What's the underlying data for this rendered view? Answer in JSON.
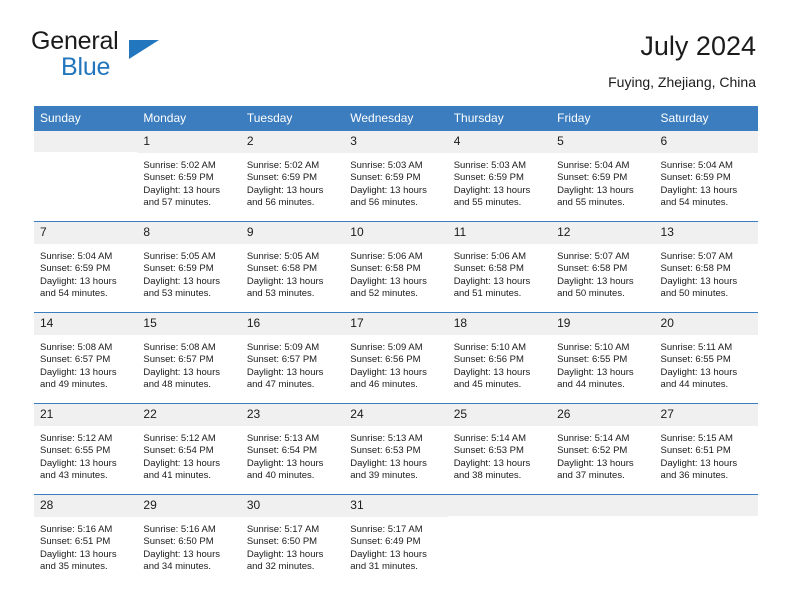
{
  "brand": {
    "line1": "General",
    "line2": "Blue",
    "accent_color": "#2176bd"
  },
  "header": {
    "title": "July 2024",
    "subtitle": "Fuying, Zhejiang, China",
    "header_bg": "#3b7dbf",
    "daynum_bg": "#f0f0f0"
  },
  "weekdays": [
    "Sunday",
    "Monday",
    "Tuesday",
    "Wednesday",
    "Thursday",
    "Friday",
    "Saturday"
  ],
  "labels": {
    "sunrise_prefix": "Sunrise:",
    "sunset_prefix": "Sunset:",
    "daylight_prefix": "Daylight:"
  },
  "weeks": [
    [
      {
        "day": "",
        "empty": true
      },
      {
        "day": "1",
        "sunrise": "Sunrise: 5:02 AM",
        "sunset": "Sunset: 6:59 PM",
        "daylight1": "Daylight: 13 hours",
        "daylight2": "and 57 minutes."
      },
      {
        "day": "2",
        "sunrise": "Sunrise: 5:02 AM",
        "sunset": "Sunset: 6:59 PM",
        "daylight1": "Daylight: 13 hours",
        "daylight2": "and 56 minutes."
      },
      {
        "day": "3",
        "sunrise": "Sunrise: 5:03 AM",
        "sunset": "Sunset: 6:59 PM",
        "daylight1": "Daylight: 13 hours",
        "daylight2": "and 56 minutes."
      },
      {
        "day": "4",
        "sunrise": "Sunrise: 5:03 AM",
        "sunset": "Sunset: 6:59 PM",
        "daylight1": "Daylight: 13 hours",
        "daylight2": "and 55 minutes."
      },
      {
        "day": "5",
        "sunrise": "Sunrise: 5:04 AM",
        "sunset": "Sunset: 6:59 PM",
        "daylight1": "Daylight: 13 hours",
        "daylight2": "and 55 minutes."
      },
      {
        "day": "6",
        "sunrise": "Sunrise: 5:04 AM",
        "sunset": "Sunset: 6:59 PM",
        "daylight1": "Daylight: 13 hours",
        "daylight2": "and 54 minutes."
      }
    ],
    [
      {
        "day": "7",
        "sunrise": "Sunrise: 5:04 AM",
        "sunset": "Sunset: 6:59 PM",
        "daylight1": "Daylight: 13 hours",
        "daylight2": "and 54 minutes."
      },
      {
        "day": "8",
        "sunrise": "Sunrise: 5:05 AM",
        "sunset": "Sunset: 6:59 PM",
        "daylight1": "Daylight: 13 hours",
        "daylight2": "and 53 minutes."
      },
      {
        "day": "9",
        "sunrise": "Sunrise: 5:05 AM",
        "sunset": "Sunset: 6:58 PM",
        "daylight1": "Daylight: 13 hours",
        "daylight2": "and 53 minutes."
      },
      {
        "day": "10",
        "sunrise": "Sunrise: 5:06 AM",
        "sunset": "Sunset: 6:58 PM",
        "daylight1": "Daylight: 13 hours",
        "daylight2": "and 52 minutes."
      },
      {
        "day": "11",
        "sunrise": "Sunrise: 5:06 AM",
        "sunset": "Sunset: 6:58 PM",
        "daylight1": "Daylight: 13 hours",
        "daylight2": "and 51 minutes."
      },
      {
        "day": "12",
        "sunrise": "Sunrise: 5:07 AM",
        "sunset": "Sunset: 6:58 PM",
        "daylight1": "Daylight: 13 hours",
        "daylight2": "and 50 minutes."
      },
      {
        "day": "13",
        "sunrise": "Sunrise: 5:07 AM",
        "sunset": "Sunset: 6:58 PM",
        "daylight1": "Daylight: 13 hours",
        "daylight2": "and 50 minutes."
      }
    ],
    [
      {
        "day": "14",
        "sunrise": "Sunrise: 5:08 AM",
        "sunset": "Sunset: 6:57 PM",
        "daylight1": "Daylight: 13 hours",
        "daylight2": "and 49 minutes."
      },
      {
        "day": "15",
        "sunrise": "Sunrise: 5:08 AM",
        "sunset": "Sunset: 6:57 PM",
        "daylight1": "Daylight: 13 hours",
        "daylight2": "and 48 minutes."
      },
      {
        "day": "16",
        "sunrise": "Sunrise: 5:09 AM",
        "sunset": "Sunset: 6:57 PM",
        "daylight1": "Daylight: 13 hours",
        "daylight2": "and 47 minutes."
      },
      {
        "day": "17",
        "sunrise": "Sunrise: 5:09 AM",
        "sunset": "Sunset: 6:56 PM",
        "daylight1": "Daylight: 13 hours",
        "daylight2": "and 46 minutes."
      },
      {
        "day": "18",
        "sunrise": "Sunrise: 5:10 AM",
        "sunset": "Sunset: 6:56 PM",
        "daylight1": "Daylight: 13 hours",
        "daylight2": "and 45 minutes."
      },
      {
        "day": "19",
        "sunrise": "Sunrise: 5:10 AM",
        "sunset": "Sunset: 6:55 PM",
        "daylight1": "Daylight: 13 hours",
        "daylight2": "and 44 minutes."
      },
      {
        "day": "20",
        "sunrise": "Sunrise: 5:11 AM",
        "sunset": "Sunset: 6:55 PM",
        "daylight1": "Daylight: 13 hours",
        "daylight2": "and 44 minutes."
      }
    ],
    [
      {
        "day": "21",
        "sunrise": "Sunrise: 5:12 AM",
        "sunset": "Sunset: 6:55 PM",
        "daylight1": "Daylight: 13 hours",
        "daylight2": "and 43 minutes."
      },
      {
        "day": "22",
        "sunrise": "Sunrise: 5:12 AM",
        "sunset": "Sunset: 6:54 PM",
        "daylight1": "Daylight: 13 hours",
        "daylight2": "and 41 minutes."
      },
      {
        "day": "23",
        "sunrise": "Sunrise: 5:13 AM",
        "sunset": "Sunset: 6:54 PM",
        "daylight1": "Daylight: 13 hours",
        "daylight2": "and 40 minutes."
      },
      {
        "day": "24",
        "sunrise": "Sunrise: 5:13 AM",
        "sunset": "Sunset: 6:53 PM",
        "daylight1": "Daylight: 13 hours",
        "daylight2": "and 39 minutes."
      },
      {
        "day": "25",
        "sunrise": "Sunrise: 5:14 AM",
        "sunset": "Sunset: 6:53 PM",
        "daylight1": "Daylight: 13 hours",
        "daylight2": "and 38 minutes."
      },
      {
        "day": "26",
        "sunrise": "Sunrise: 5:14 AM",
        "sunset": "Sunset: 6:52 PM",
        "daylight1": "Daylight: 13 hours",
        "daylight2": "and 37 minutes."
      },
      {
        "day": "27",
        "sunrise": "Sunrise: 5:15 AM",
        "sunset": "Sunset: 6:51 PM",
        "daylight1": "Daylight: 13 hours",
        "daylight2": "and 36 minutes."
      }
    ],
    [
      {
        "day": "28",
        "sunrise": "Sunrise: 5:16 AM",
        "sunset": "Sunset: 6:51 PM",
        "daylight1": "Daylight: 13 hours",
        "daylight2": "and 35 minutes."
      },
      {
        "day": "29",
        "sunrise": "Sunrise: 5:16 AM",
        "sunset": "Sunset: 6:50 PM",
        "daylight1": "Daylight: 13 hours",
        "daylight2": "and 34 minutes."
      },
      {
        "day": "30",
        "sunrise": "Sunrise: 5:17 AM",
        "sunset": "Sunset: 6:50 PM",
        "daylight1": "Daylight: 13 hours",
        "daylight2": "and 32 minutes."
      },
      {
        "day": "31",
        "sunrise": "Sunrise: 5:17 AM",
        "sunset": "Sunset: 6:49 PM",
        "daylight1": "Daylight: 13 hours",
        "daylight2": "and 31 minutes."
      },
      {
        "day": "",
        "empty": true
      },
      {
        "day": "",
        "empty": true
      },
      {
        "day": "",
        "empty": true
      }
    ]
  ]
}
